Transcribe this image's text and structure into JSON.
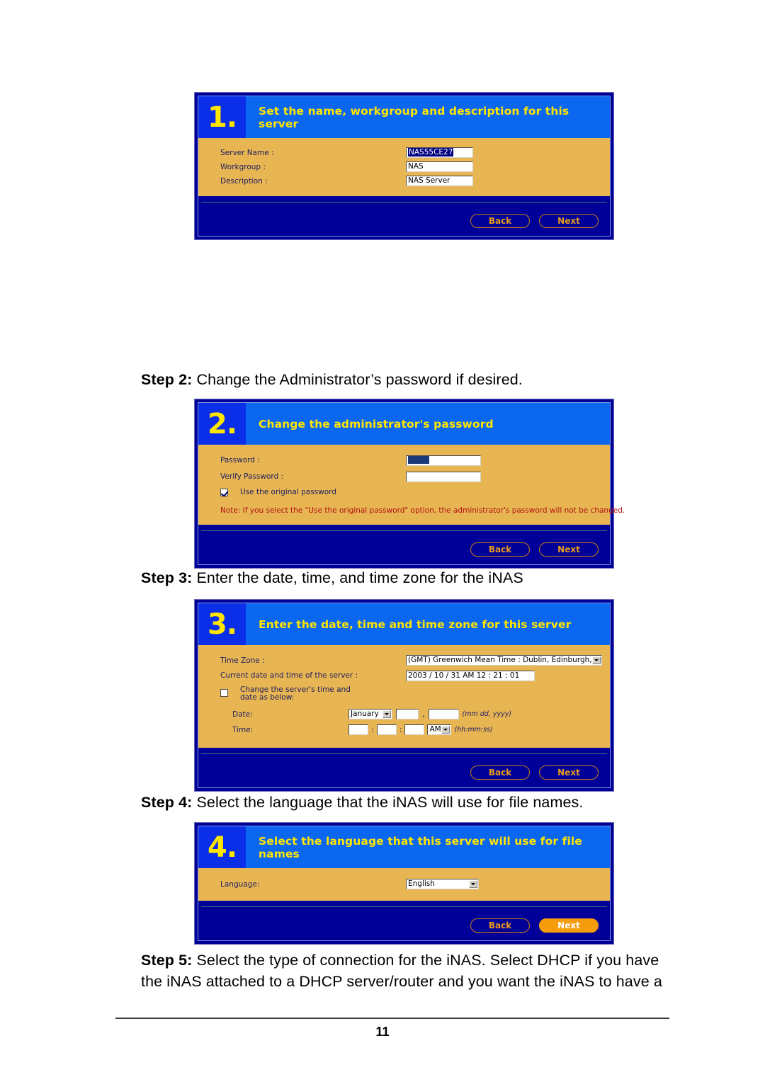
{
  "document": {
    "page_number": "11",
    "paragraphs": [
      {
        "id": "step2",
        "label": "Step 2:",
        "text": " Change the Administrator’s password if desired."
      },
      {
        "id": "step3",
        "label": "Step 3:",
        "text": " Enter the date, time, and time zone for the iNAS"
      },
      {
        "id": "step4",
        "label": "Step 4:",
        "text": " Select the language that the iNAS will use for file names."
      },
      {
        "id": "step5",
        "label": "Step 5:",
        "text": " Select the type of connection for the iNAS. Select DHCP if you have the iNAS attached to a DHCP server/router and you want the iNAS to have a"
      }
    ]
  },
  "colors": {
    "panel_outer_blue": "#000099",
    "header_blue": "#0b66f0",
    "number_blue": "#0b2fe8",
    "body_tan": "#e8b553",
    "title_yellow": "#ffe600",
    "button_orange": "#e79a1a",
    "button_orange_filled": "#f59c0b",
    "note_red": "#b01010"
  },
  "wizard1": {
    "number": "1.",
    "title": "Set the name, workgroup and description for this server",
    "fields": [
      {
        "label": "Server Name :",
        "value": "NAS55CE27",
        "selected": true
      },
      {
        "label": "Workgroup :",
        "value": "NAS",
        "selected": false
      },
      {
        "label": "Description :",
        "value": "NAS Server",
        "selected": false
      }
    ],
    "buttons": {
      "back": "Back",
      "next": "Next"
    }
  },
  "wizard2": {
    "number": "2.",
    "title": "Change the administrator's password",
    "password_label": "Password :",
    "password_value": "",
    "verify_label": "Verify Password :",
    "verify_value": "",
    "checkbox_label": "Use the original password",
    "checkbox_checked": true,
    "note": "Note: If you select the \"Use the original password\" option, the administrator's password will not be changed.",
    "buttons": {
      "back": "Back",
      "next": "Next"
    }
  },
  "wizard3": {
    "number": "3.",
    "title": "Enter the date, time and time zone for this server",
    "timezone_label": "Time Zone :",
    "timezone_value": "(GMT) Greenwich Mean Time : Dublin, Edinburgh, Lisbon, London",
    "current_label": "Current date and time of the server :",
    "current_value": "2003 / 10 / 31 AM 12 : 21 : 01",
    "change_checkbox_label": "Change the server's time and date as below:",
    "change_checkbox_checked": false,
    "date_label": "Date:",
    "date_month": "January",
    "date_day": "",
    "date_year": "",
    "date_hint": "(mm dd, yyyy)",
    "date_comma": ",",
    "time_label": "Time:",
    "time_hour": "",
    "time_minute": "",
    "time_second": "",
    "time_meridiem": "AM",
    "time_hint": "(hh:mm:ss)",
    "time_colon": ":",
    "buttons": {
      "back": "Back",
      "next": "Next"
    }
  },
  "wizard4": {
    "number": "4.",
    "title": "Select the language that this server will use for file names",
    "language_label": "Language:",
    "language_value": "English",
    "buttons": {
      "back": "Back",
      "next": "Next"
    }
  }
}
